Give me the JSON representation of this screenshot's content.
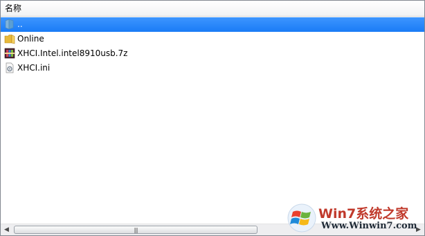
{
  "header": {
    "column_name": "名称"
  },
  "files": [
    {
      "name": "..",
      "icon": "folder-up-icon",
      "selected": true
    },
    {
      "name": "Online",
      "icon": "folder-icon",
      "selected": false
    },
    {
      "name": "XHCI.Intel.intel8910usb.7z",
      "icon": "archive-icon",
      "selected": false
    },
    {
      "name": "XHCI.ini",
      "icon": "settings-file-icon",
      "selected": false
    }
  ],
  "scrollbar": {
    "left_arrow": "◀",
    "right_arrow": "▶",
    "grip": "|||"
  },
  "watermark": {
    "title": "Win7系统之家",
    "url": "Www.Winwin7.com"
  },
  "colors": {
    "selection": "#3d95ff",
    "border": "#828790",
    "watermark_title": "#c0392b"
  }
}
